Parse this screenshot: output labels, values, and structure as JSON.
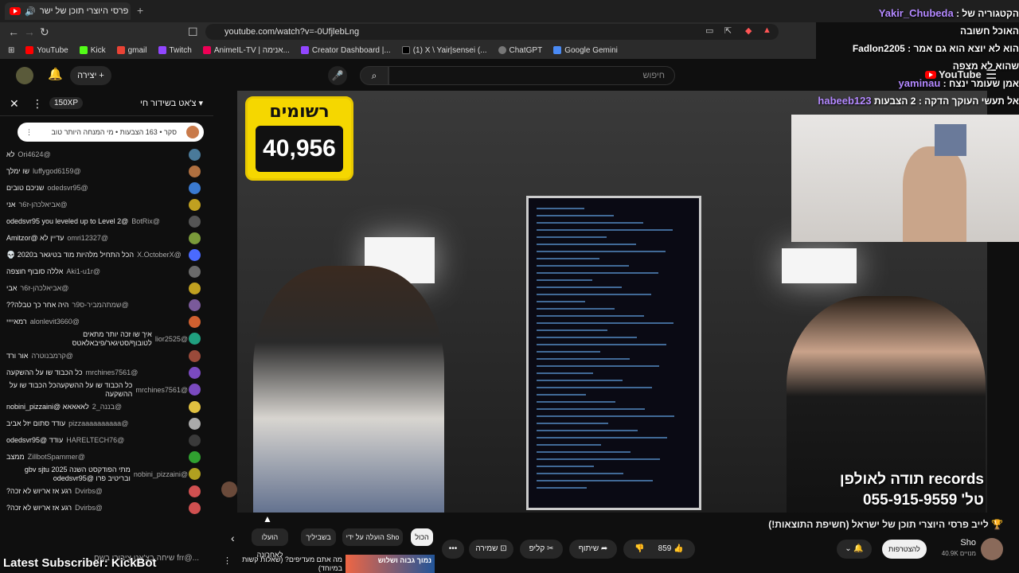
{
  "browser": {
    "tab_title": "לייב פרסי היוצרי תוכן של ישר...",
    "url": "youtube.com/watch?v=-0UfjlebLng",
    "bookmarks": [
      "YouTube",
      "Kick",
      "gmail",
      "Twitch",
      "AnimeIL-TV | אנימה...",
      "Creator Dashboard |...",
      "(1) X \\ Yair|sensei (...",
      "ChatGPT",
      "Google Gemini"
    ]
  },
  "header": {
    "search_placeholder": "חיפוש",
    "create_label": "יצירה",
    "logo_text": "YouTube"
  },
  "chat": {
    "title": "צ'אט בשידור חי",
    "xp": "150XP",
    "poll_text": "סקר • 163 הצבעות • מי המנחה היותר טוב",
    "input_placeholder": "שיחה בצ'אט ציבורי בשם frr@...",
    "messages": [
      {
        "user": "@Ori4624",
        "text": "לא",
        "color": "#4a7a9a"
      },
      {
        "user": "@luffygod6159",
        "text": "שו ימלך",
        "color": "#b07040"
      },
      {
        "user": "@odedsvr95",
        "text": "שניכם טובים",
        "color": "#3a7ad0"
      },
      {
        "user": "@אביאלכהן-ז6ר",
        "text": "אני",
        "color": "#c0a020"
      },
      {
        "user": "@BotRix",
        "text": "@odedsvr95 you leveled up to Level 2",
        "color": "#555555"
      },
      {
        "user": "@omri12327",
        "text": "עדיין לא @Amitzor",
        "color": "#7a9a3a"
      },
      {
        "user": "@X.OctoberX",
        "text": "הכל התחיל מלהיות מוד בטיגאר ב2020 💀",
        "color": "#4a6aff"
      },
      {
        "user": "@Aki1-u1r",
        "text": "אללה סובוף חוצפה",
        "color": "#6a6a6a"
      },
      {
        "user": "@אביאלכהן-ז6ר",
        "text": "אבי",
        "color": "#c0a020"
      },
      {
        "user": "@שמתהמביר-ס9ר",
        "text": "היה אחר כך טבלה??",
        "color": "#7a5a9a"
      },
      {
        "user": "@alonlevit3660",
        "text": "רמאיייי",
        "color": "#d06030"
      },
      {
        "user": "@lior2525",
        "text": "איך שו זכה יותר מתאים לטובוף/סטיגאר/פיבאלאטס",
        "color": "#20a080"
      },
      {
        "user": "@קרמבנוטרה",
        "text": "אור ורד",
        "color": "#9a4a3a"
      },
      {
        "user": "@mrchines7561",
        "text": "כל הכבוד שו על ההשקעה",
        "color": "#7a4ac0"
      },
      {
        "user": "@mrchines7561",
        "text": "כל הכבוד שו על ההשקעהכל הכבוד שו על ההשקעה",
        "color": "#7a4ac0"
      },
      {
        "user": "@בננה_2",
        "text": "לאאאאא @nobini_pizzaini",
        "color": "#e0c040"
      },
      {
        "user": "@pizzaaaaaaaaaa",
        "text": "עודד סתום יזל אביב",
        "color": "#aaaaaa"
      },
      {
        "user": "@HARELTECH76",
        "text": "עודד @odedsvr95",
        "color": "#3a3a3a"
      },
      {
        "user": "@ZillbotSpammer",
        "text": "ממצב",
        "color": "#30a030"
      },
      {
        "user": "@nobini_pizzaini",
        "text": "מתי הפודקסט השנה 2025 gbv sjtu ובריטיב פרו @odedsvr95",
        "color": "#b0a020"
      },
      {
        "user": "@Dvirbs",
        "text": "רגע אז אריוש לא זכה?",
        "color": "#d05050"
      },
      {
        "user": "@Dvirbs",
        "text": "רגע אז אריוש לא זכה?",
        "color": "#d05050"
      }
    ]
  },
  "overlay": {
    "lines": [
      {
        "user": "Yakir_Chubeda",
        "text": "הקטגוריה של :"
      },
      {
        "user": "",
        "text": "האוכל חשובה"
      },
      {
        "user": "",
        "text": "הוא לא יוצא הוא גם אמר : Fadlon2205"
      },
      {
        "user": "",
        "text": "שהוא לא מצפה"
      },
      {
        "user": "yaminau",
        "text": "אמן שעומר ינצח :"
      },
      {
        "user": "habeeb123",
        "text": "אל תעשי העוקך הדקה : 2 הצבעות"
      }
    ]
  },
  "video": {
    "registered_label": "רשומים",
    "registered_count": "40,956",
    "records_line1": "תודה לאולפן records",
    "records_line2": "טל' 055-915-9559",
    "title": "🏆 לייב פרסי היוצרי תוכן של ישראל (חשיפת התוצאות!)",
    "likes": "859",
    "share_label": "שיתוף",
    "clip_label": "קליפ",
    "save_label": "שמירה",
    "subscribe_label": "להצטרפות",
    "channel_name": "Sho",
    "channel_subs": "40.9K מנויים"
  },
  "filters": [
    "הכול",
    "הועלה על ידי Sho",
    "בשביליך",
    "הועלו לאחרונה"
  ],
  "recommendation": {
    "title": "מה אתם מעדיפים? (שאלות קשות במיוחד)",
    "thumb_text": "נמוך גבוה ושלוש"
  },
  "stream_overlay": {
    "latest_subscriber": "Latest Subscriber: KickBot"
  }
}
